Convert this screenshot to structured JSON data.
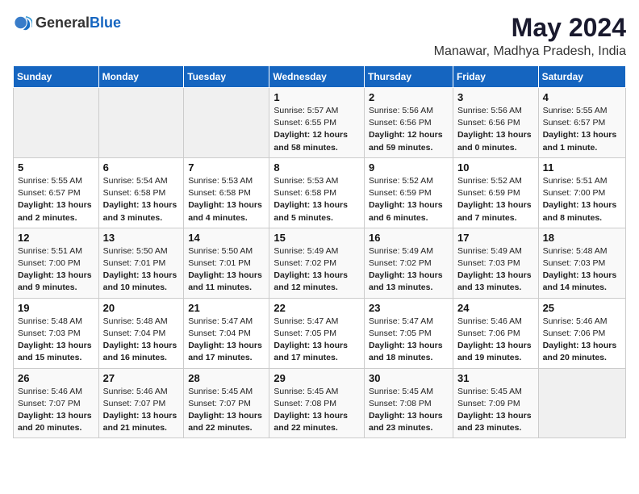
{
  "logo": {
    "general": "General",
    "blue": "Blue"
  },
  "title": "May 2024",
  "subtitle": "Manawar, Madhya Pradesh, India",
  "days_of_week": [
    "Sunday",
    "Monday",
    "Tuesday",
    "Wednesday",
    "Thursday",
    "Friday",
    "Saturday"
  ],
  "weeks": [
    [
      {
        "day": "",
        "info": ""
      },
      {
        "day": "",
        "info": ""
      },
      {
        "day": "",
        "info": ""
      },
      {
        "day": "1",
        "info": "Sunrise: 5:57 AM\nSunset: 6:55 PM\nDaylight: 12 hours and 58 minutes."
      },
      {
        "day": "2",
        "info": "Sunrise: 5:56 AM\nSunset: 6:56 PM\nDaylight: 12 hours and 59 minutes."
      },
      {
        "day": "3",
        "info": "Sunrise: 5:56 AM\nSunset: 6:56 PM\nDaylight: 13 hours and 0 minutes."
      },
      {
        "day": "4",
        "info": "Sunrise: 5:55 AM\nSunset: 6:57 PM\nDaylight: 13 hours and 1 minute."
      }
    ],
    [
      {
        "day": "5",
        "info": "Sunrise: 5:55 AM\nSunset: 6:57 PM\nDaylight: 13 hours and 2 minutes."
      },
      {
        "day": "6",
        "info": "Sunrise: 5:54 AM\nSunset: 6:58 PM\nDaylight: 13 hours and 3 minutes."
      },
      {
        "day": "7",
        "info": "Sunrise: 5:53 AM\nSunset: 6:58 PM\nDaylight: 13 hours and 4 minutes."
      },
      {
        "day": "8",
        "info": "Sunrise: 5:53 AM\nSunset: 6:58 PM\nDaylight: 13 hours and 5 minutes."
      },
      {
        "day": "9",
        "info": "Sunrise: 5:52 AM\nSunset: 6:59 PM\nDaylight: 13 hours and 6 minutes."
      },
      {
        "day": "10",
        "info": "Sunrise: 5:52 AM\nSunset: 6:59 PM\nDaylight: 13 hours and 7 minutes."
      },
      {
        "day": "11",
        "info": "Sunrise: 5:51 AM\nSunset: 7:00 PM\nDaylight: 13 hours and 8 minutes."
      }
    ],
    [
      {
        "day": "12",
        "info": "Sunrise: 5:51 AM\nSunset: 7:00 PM\nDaylight: 13 hours and 9 minutes."
      },
      {
        "day": "13",
        "info": "Sunrise: 5:50 AM\nSunset: 7:01 PM\nDaylight: 13 hours and 10 minutes."
      },
      {
        "day": "14",
        "info": "Sunrise: 5:50 AM\nSunset: 7:01 PM\nDaylight: 13 hours and 11 minutes."
      },
      {
        "day": "15",
        "info": "Sunrise: 5:49 AM\nSunset: 7:02 PM\nDaylight: 13 hours and 12 minutes."
      },
      {
        "day": "16",
        "info": "Sunrise: 5:49 AM\nSunset: 7:02 PM\nDaylight: 13 hours and 13 minutes."
      },
      {
        "day": "17",
        "info": "Sunrise: 5:49 AM\nSunset: 7:03 PM\nDaylight: 13 hours and 13 minutes."
      },
      {
        "day": "18",
        "info": "Sunrise: 5:48 AM\nSunset: 7:03 PM\nDaylight: 13 hours and 14 minutes."
      }
    ],
    [
      {
        "day": "19",
        "info": "Sunrise: 5:48 AM\nSunset: 7:03 PM\nDaylight: 13 hours and 15 minutes."
      },
      {
        "day": "20",
        "info": "Sunrise: 5:48 AM\nSunset: 7:04 PM\nDaylight: 13 hours and 16 minutes."
      },
      {
        "day": "21",
        "info": "Sunrise: 5:47 AM\nSunset: 7:04 PM\nDaylight: 13 hours and 17 minutes."
      },
      {
        "day": "22",
        "info": "Sunrise: 5:47 AM\nSunset: 7:05 PM\nDaylight: 13 hours and 17 minutes."
      },
      {
        "day": "23",
        "info": "Sunrise: 5:47 AM\nSunset: 7:05 PM\nDaylight: 13 hours and 18 minutes."
      },
      {
        "day": "24",
        "info": "Sunrise: 5:46 AM\nSunset: 7:06 PM\nDaylight: 13 hours and 19 minutes."
      },
      {
        "day": "25",
        "info": "Sunrise: 5:46 AM\nSunset: 7:06 PM\nDaylight: 13 hours and 20 minutes."
      }
    ],
    [
      {
        "day": "26",
        "info": "Sunrise: 5:46 AM\nSunset: 7:07 PM\nDaylight: 13 hours and 20 minutes."
      },
      {
        "day": "27",
        "info": "Sunrise: 5:46 AM\nSunset: 7:07 PM\nDaylight: 13 hours and 21 minutes."
      },
      {
        "day": "28",
        "info": "Sunrise: 5:45 AM\nSunset: 7:07 PM\nDaylight: 13 hours and 22 minutes."
      },
      {
        "day": "29",
        "info": "Sunrise: 5:45 AM\nSunset: 7:08 PM\nDaylight: 13 hours and 22 minutes."
      },
      {
        "day": "30",
        "info": "Sunrise: 5:45 AM\nSunset: 7:08 PM\nDaylight: 13 hours and 23 minutes."
      },
      {
        "day": "31",
        "info": "Sunrise: 5:45 AM\nSunset: 7:09 PM\nDaylight: 13 hours and 23 minutes."
      },
      {
        "day": "",
        "info": ""
      }
    ]
  ]
}
